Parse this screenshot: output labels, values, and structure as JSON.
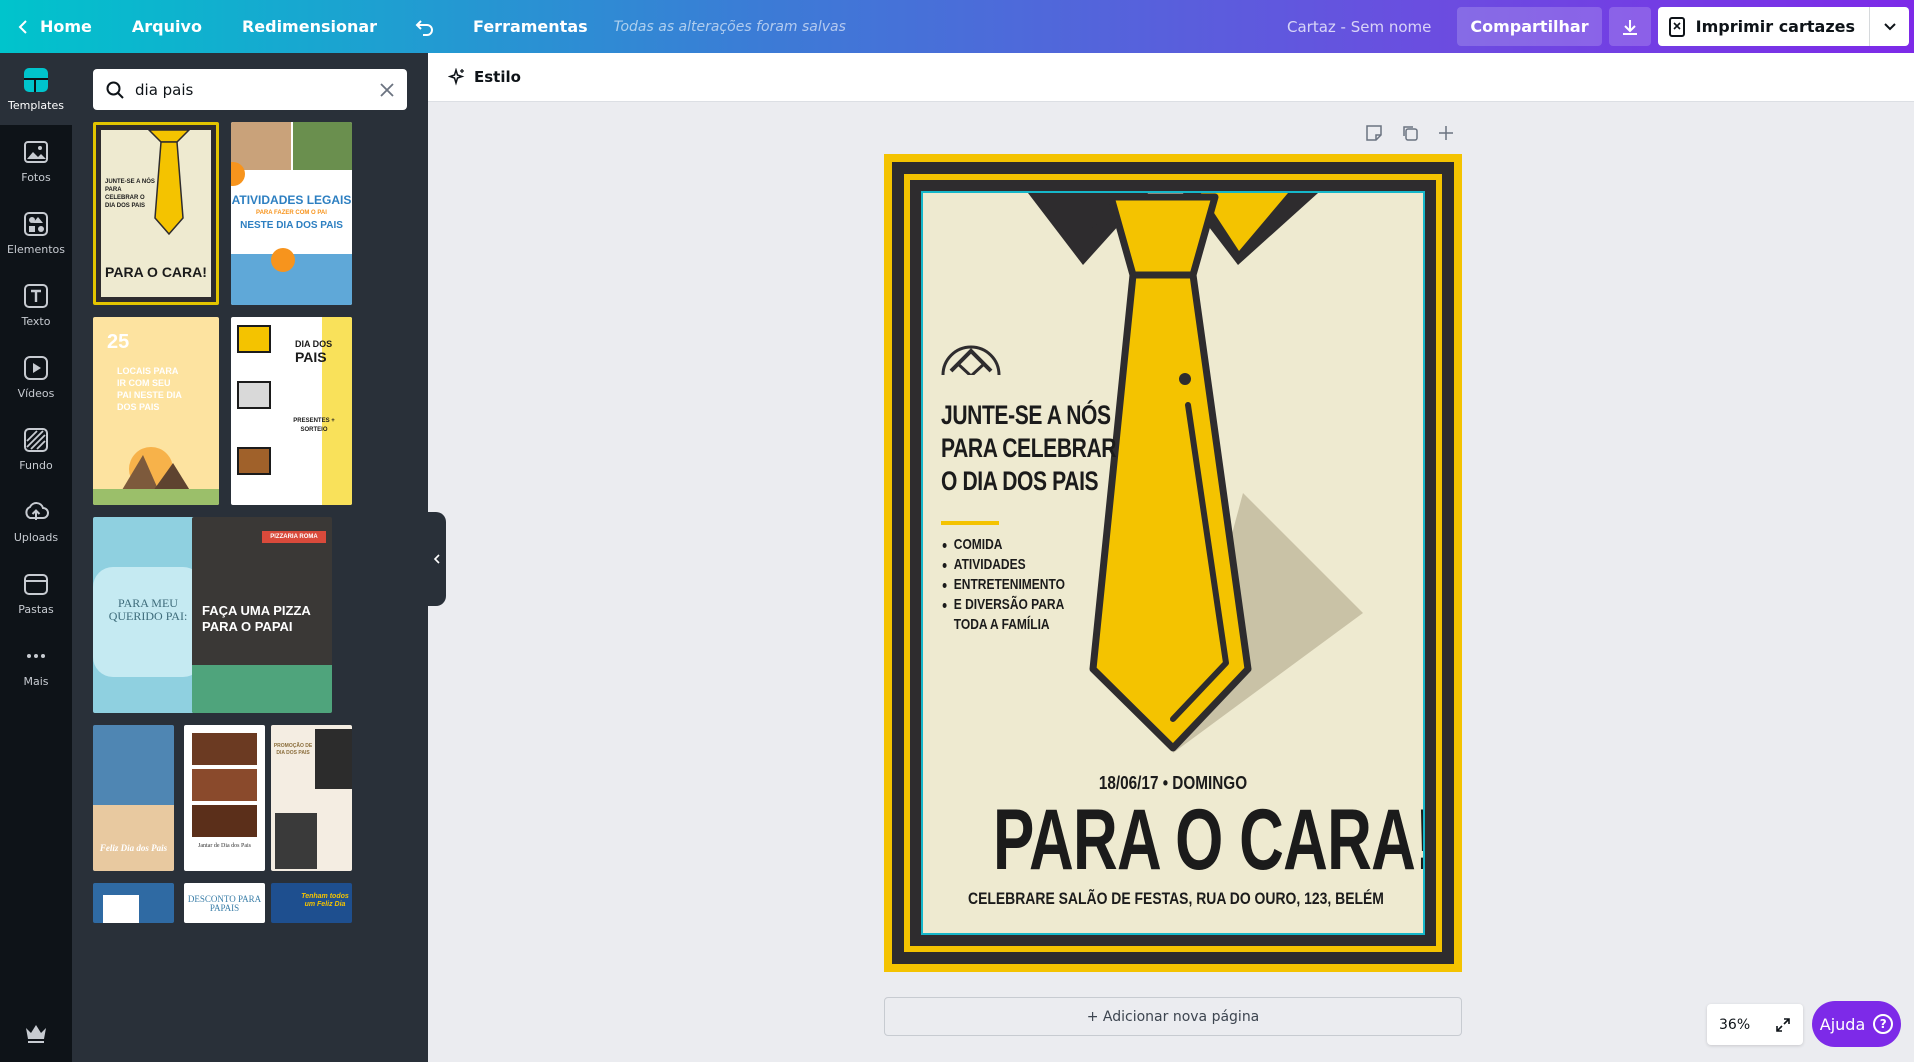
{
  "topbar": {
    "home": "Home",
    "file": "Arquivo",
    "resize": "Redimensionar",
    "tools": "Ferramentas",
    "saved_status": "Todas as alterações foram salvas",
    "doc_name": "Cartaz - Sem nome",
    "share": "Compartilhar",
    "print": "Imprimir cartazes"
  },
  "rail": [
    {
      "label": "Templates",
      "icon": "templates-icon"
    },
    {
      "label": "Fotos",
      "icon": "photos-icon"
    },
    {
      "label": "Elementos",
      "icon": "elements-icon"
    },
    {
      "label": "Texto",
      "icon": "text-icon"
    },
    {
      "label": "Vídeos",
      "icon": "videos-icon"
    },
    {
      "label": "Fundo",
      "icon": "background-icon"
    },
    {
      "label": "Uploads",
      "icon": "uploads-icon"
    },
    {
      "label": "Pastas",
      "icon": "folders-icon"
    },
    {
      "label": "Mais",
      "icon": "more-icon"
    }
  ],
  "search": {
    "value": "dia pais"
  },
  "templates": {
    "t1_head": "JUNTE-SE A NÓS PARA CELEBRAR O DIA DOS PAIS",
    "t1_title": "PARA O CARA!",
    "t2_title": "ATIVIDADES LEGAIS",
    "t2_sub": "PARA FAZER COM O PAI",
    "t2_sub2": "NESTE DIA DOS PAIS",
    "t3_num": "25",
    "t3_text": "LOCAIS PARA IR COM SEU PAI NESTE DIA DOS PAIS",
    "t4_title": "DIA DOS",
    "t4_title2": "PAIS",
    "t4_text": "PRESENTES + SORTEIO",
    "t5_title": "PARA MEU QUERIDO PAI:",
    "t6_tag": "PIZZARIA ROMA",
    "t6_title": "FAÇA UMA PIZZA PARA O PAPAI",
    "t7_title": "Feliz Dia dos Pais",
    "t8_title": "Jantar de Dia dos Pais",
    "t9_title": "PROMOÇÃO DE DIA DOS PAIS",
    "t10_title": "DESCONTO PARA PAPAIS",
    "t11_title": "Tenham todos um Feliz Dia"
  },
  "toolbar": {
    "style": "Estilo"
  },
  "poster": {
    "heading_lines": [
      "JUNTE-SE A NÓS",
      "PARA CELEBRAR",
      "O DIA DOS PAIS"
    ],
    "items": [
      "COMIDA",
      "ATIVIDADES",
      "ENTRETENIMENTO",
      "E DIVERSÃO PARA",
      "TODA A FAMÍLIA"
    ],
    "date": "18/06/17 • DOMINGO",
    "title": "PARA O CARA!",
    "address": "CELEBRARE SALÃO DE FESTAS, RUA DO OURO, 123, BELÉM"
  },
  "add_page": "+ Adicionar nova página",
  "zoom": "36%",
  "help": "Ajuda",
  "colors": {
    "accent": "#7d2ae8",
    "teal": "#00c4cc",
    "poster_yellow": "#f4c300",
    "poster_dark": "#2e2c2e",
    "poster_bg": "#eeead0"
  }
}
